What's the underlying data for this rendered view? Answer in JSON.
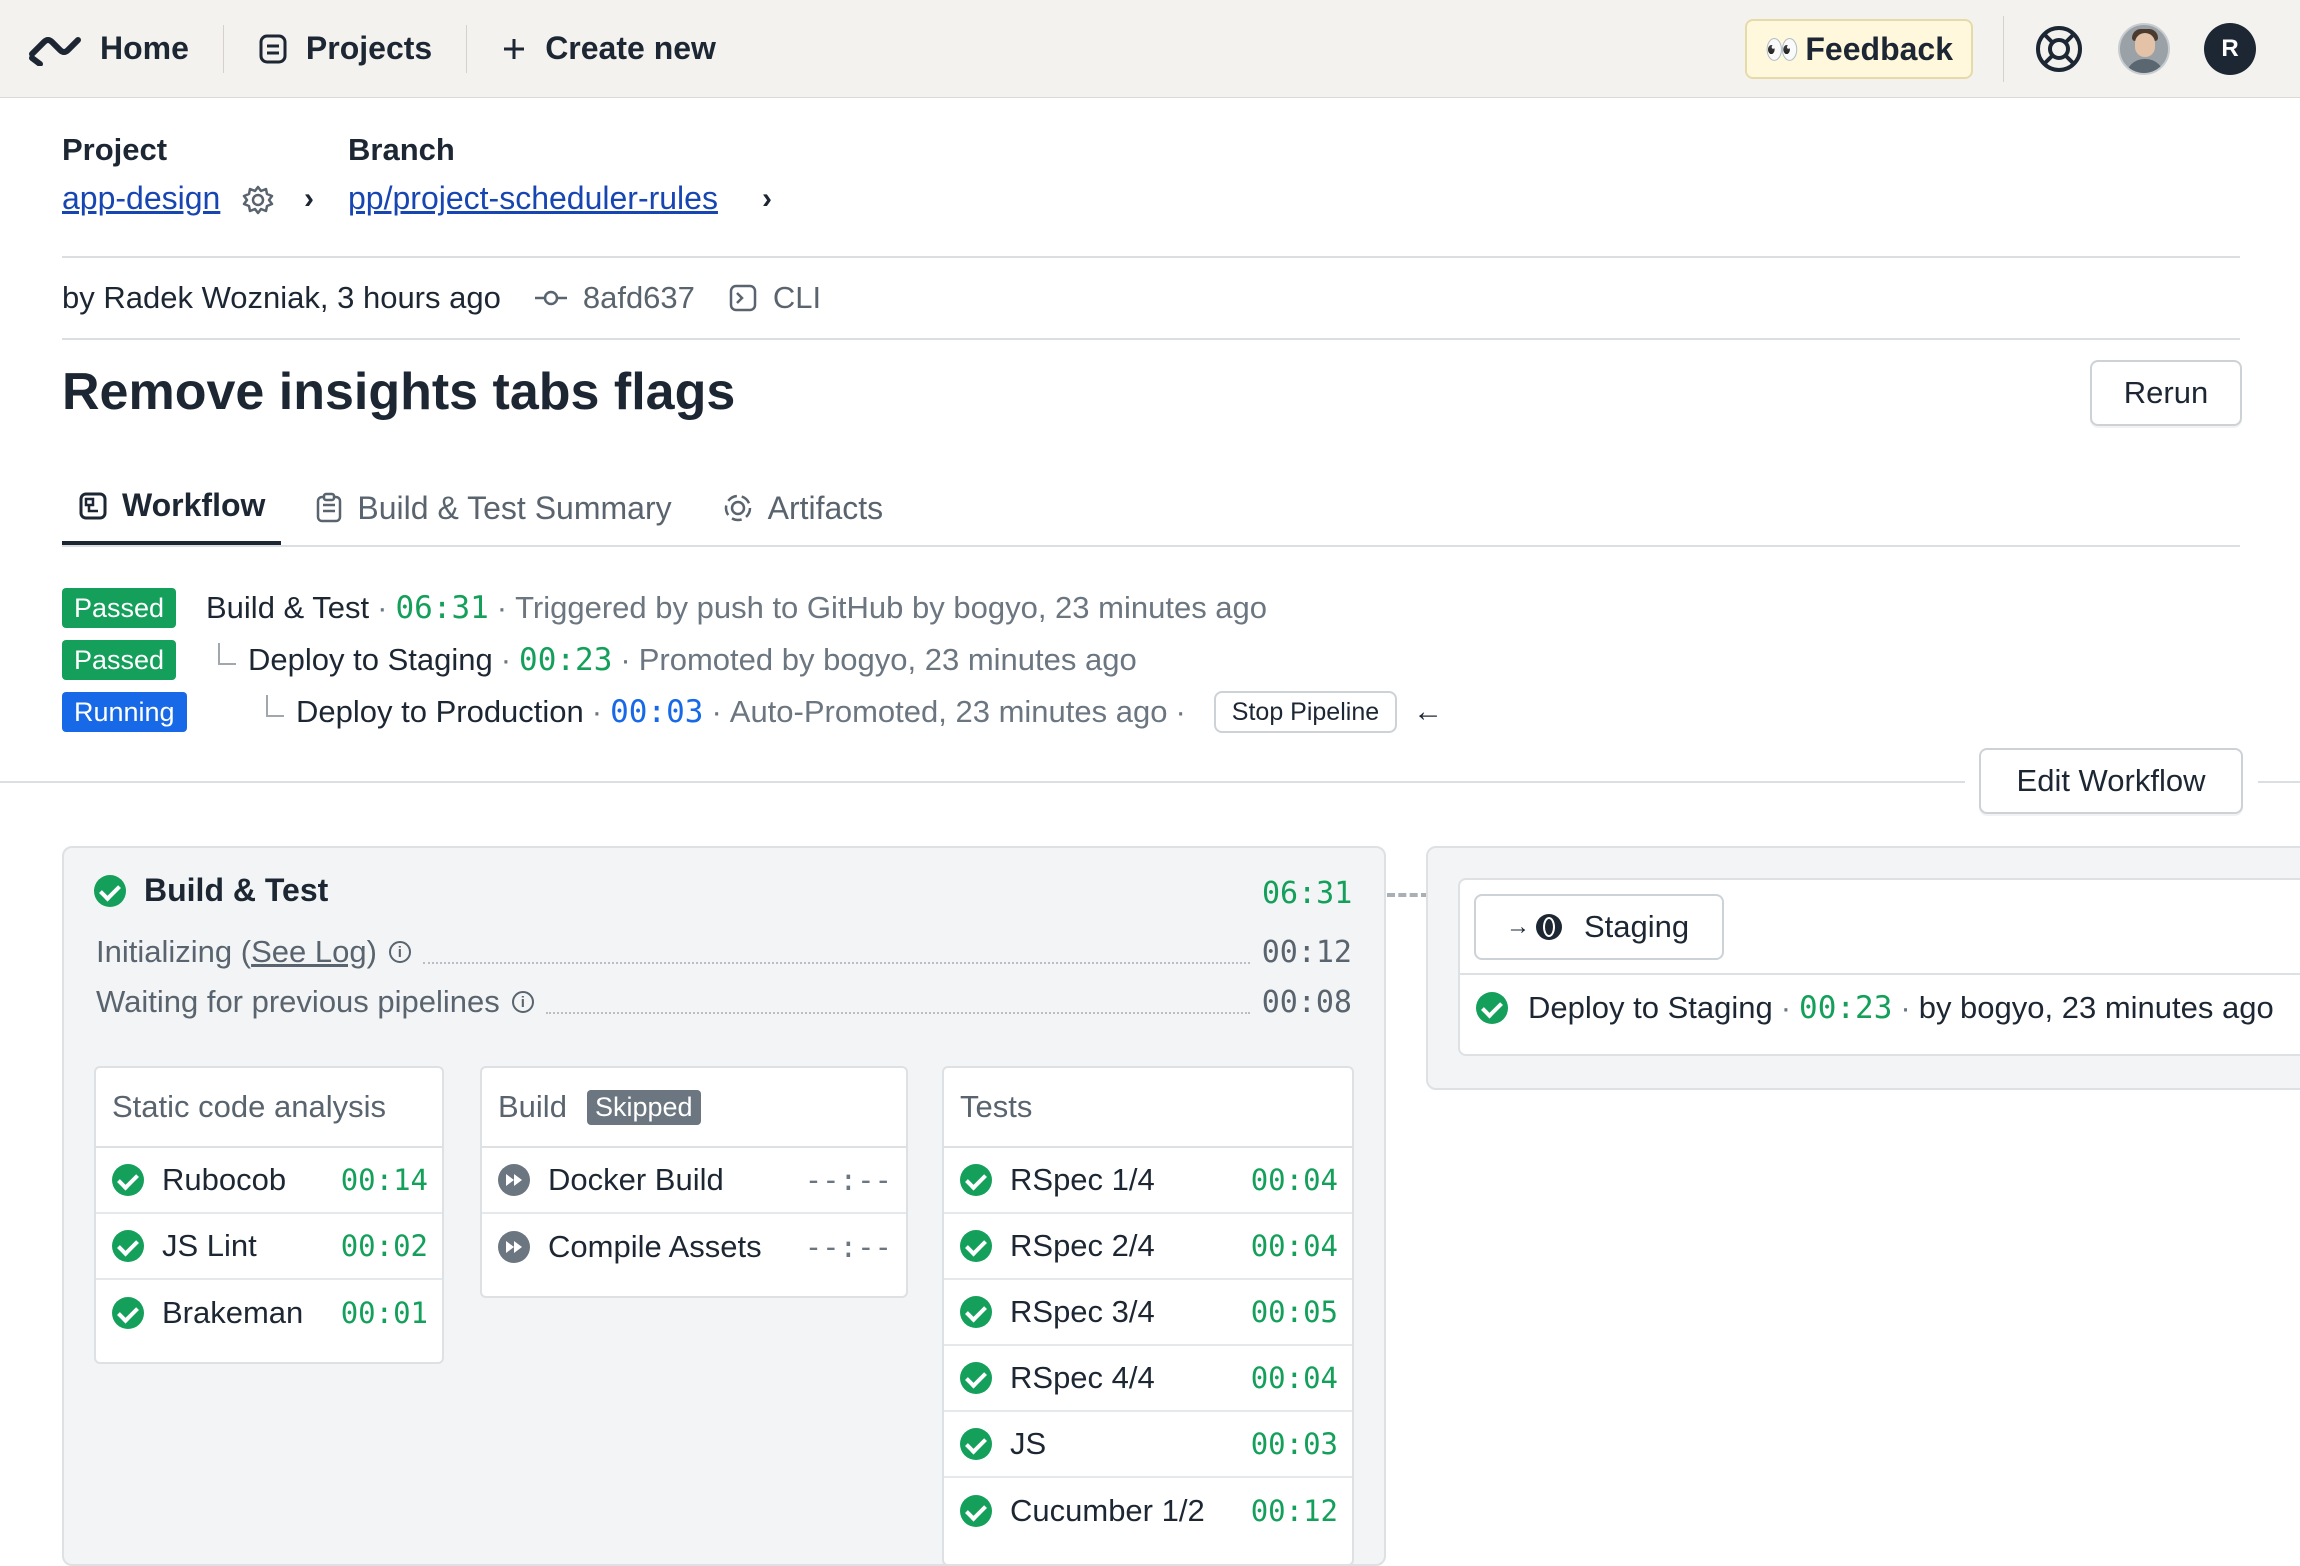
{
  "nav": {
    "home": "Home",
    "projects": "Projects",
    "create": "Create new",
    "feedback_emoji": "👀",
    "feedback": "Feedback",
    "avatar_initial": "R"
  },
  "header": {
    "project_label": "Project",
    "project_name": "app-design",
    "branch_label": "Branch",
    "branch_name": "pp/project-scheduler-rules",
    "chevron": "›",
    "author_line": "by Radek Wozniak, 3 hours ago",
    "commit_sha": "8afd637",
    "source": "CLI",
    "title": "Remove insights tabs flags",
    "rerun": "Rerun"
  },
  "tabs": [
    {
      "label": "Workflow",
      "active": true
    },
    {
      "label": "Build & Test Summary",
      "active": false
    },
    {
      "label": "Artifacts",
      "active": false
    }
  ],
  "pipelines": [
    {
      "status": "Passed",
      "name": "Build & Test",
      "time": "06:31",
      "detail": "Triggered by push to GitHub by bogyo, 23 minutes ago"
    },
    {
      "status": "Passed",
      "name": "Deploy to Staging",
      "time": "00:23",
      "detail": "Promoted by bogyo, 23 minutes ago"
    },
    {
      "status": "Running",
      "name": "Deploy to Production",
      "time": "00:03",
      "detail": "Auto-Promoted, 23 minutes ago",
      "action": "Stop Pipeline",
      "arrow": "←"
    }
  ],
  "separator": "·",
  "edit_workflow": "Edit Workflow",
  "build_test": {
    "title": "Build & Test",
    "time": "06:31",
    "init_label": "Initializing (",
    "see_log": "See Log",
    "init_close": ")",
    "init_time": "00:12",
    "waiting_label": "Waiting for previous pipelines",
    "waiting_time": "00:08",
    "blocks": [
      {
        "name": "Static code analysis",
        "jobs": [
          {
            "name": "Rubocob",
            "time": "00:14",
            "state": "passed"
          },
          {
            "name": "JS Lint",
            "time": "00:02",
            "state": "passed"
          },
          {
            "name": "Brakeman",
            "time": "00:01",
            "state": "passed"
          }
        ]
      },
      {
        "name": "Build",
        "badge": "Skipped",
        "jobs": [
          {
            "name": "Docker Build",
            "time": "--:--",
            "state": "skipped"
          },
          {
            "name": "Compile Assets",
            "time": "--:--",
            "state": "skipped"
          }
        ]
      },
      {
        "name": "Tests",
        "jobs": [
          {
            "name": "RSpec 1/4",
            "time": "00:04",
            "state": "passed"
          },
          {
            "name": "RSpec 2/4",
            "time": "00:04",
            "state": "passed"
          },
          {
            "name": "RSpec 3/4",
            "time": "00:05",
            "state": "passed"
          },
          {
            "name": "RSpec 4/4",
            "time": "00:04",
            "state": "passed"
          },
          {
            "name": "JS",
            "time": "00:03",
            "state": "passed"
          },
          {
            "name": "Cucumber 1/2",
            "time": "00:12",
            "state": "passed"
          }
        ]
      }
    ]
  },
  "staging": {
    "target": "Staging",
    "arrow": "→",
    "row_name": "Deploy to Staging",
    "row_time": "00:23",
    "row_detail": "by bogyo, 23 minutes ago"
  },
  "colors": {
    "passed": "#14a05a",
    "running": "#1769e8",
    "link": "#1746b3",
    "feedback_bg": "#fff8dc"
  }
}
